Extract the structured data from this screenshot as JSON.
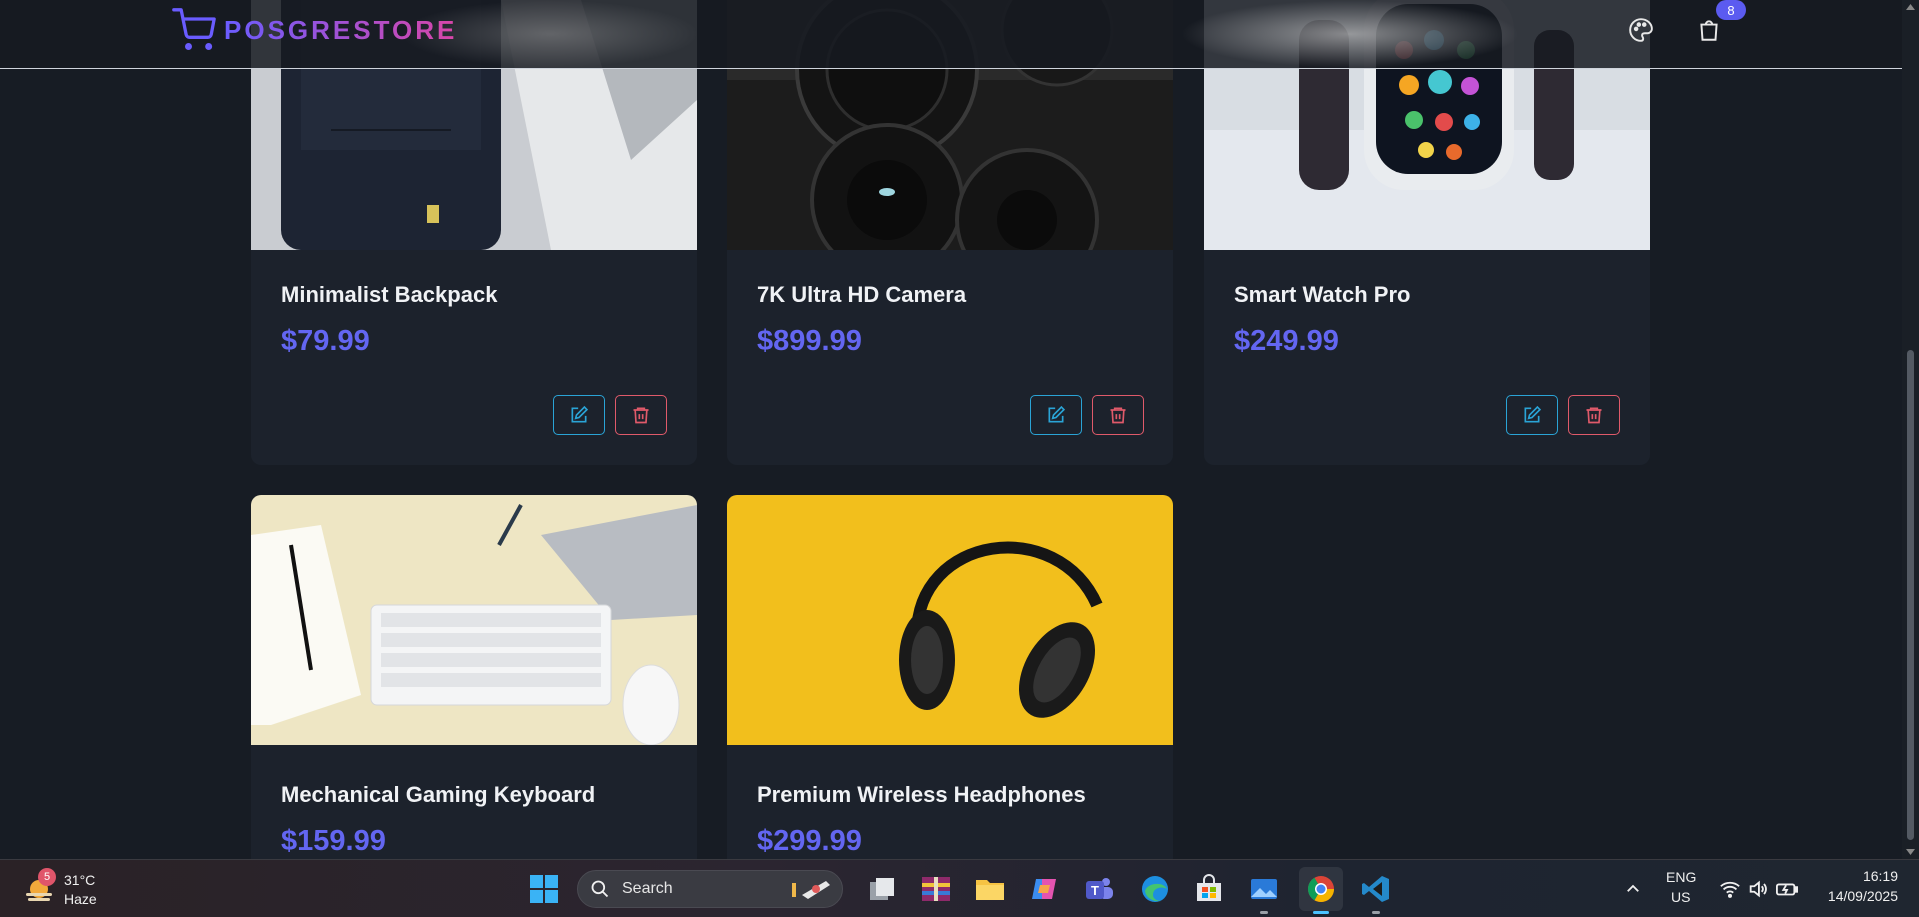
{
  "header": {
    "logo_text": "POSGRESTORE",
    "cart_count": "8"
  },
  "products": [
    {
      "name": "Minimalist Backpack",
      "price": "$79.99"
    },
    {
      "name": "7K Ultra HD Camera",
      "price": "$899.99"
    },
    {
      "name": "Smart Watch Pro",
      "price": "$249.99"
    },
    {
      "name": "Mechanical Gaming Keyboard",
      "price": "$159.99"
    },
    {
      "name": "Premium Wireless Headphones",
      "price": "$299.99"
    }
  ],
  "taskbar": {
    "weather_temp": "31°C",
    "weather_desc": "Haze",
    "weather_badge": "5",
    "search_label": "Search",
    "lang_line1": "ENG",
    "lang_line2": "US",
    "time": "16:19",
    "date": "14/09/2025"
  },
  "colors": {
    "accent": "#6366f1",
    "edit_border": "#2aa4d6",
    "delete_border": "#e05a6a",
    "background": "#171c24",
    "card_bg": "#1c222c"
  }
}
